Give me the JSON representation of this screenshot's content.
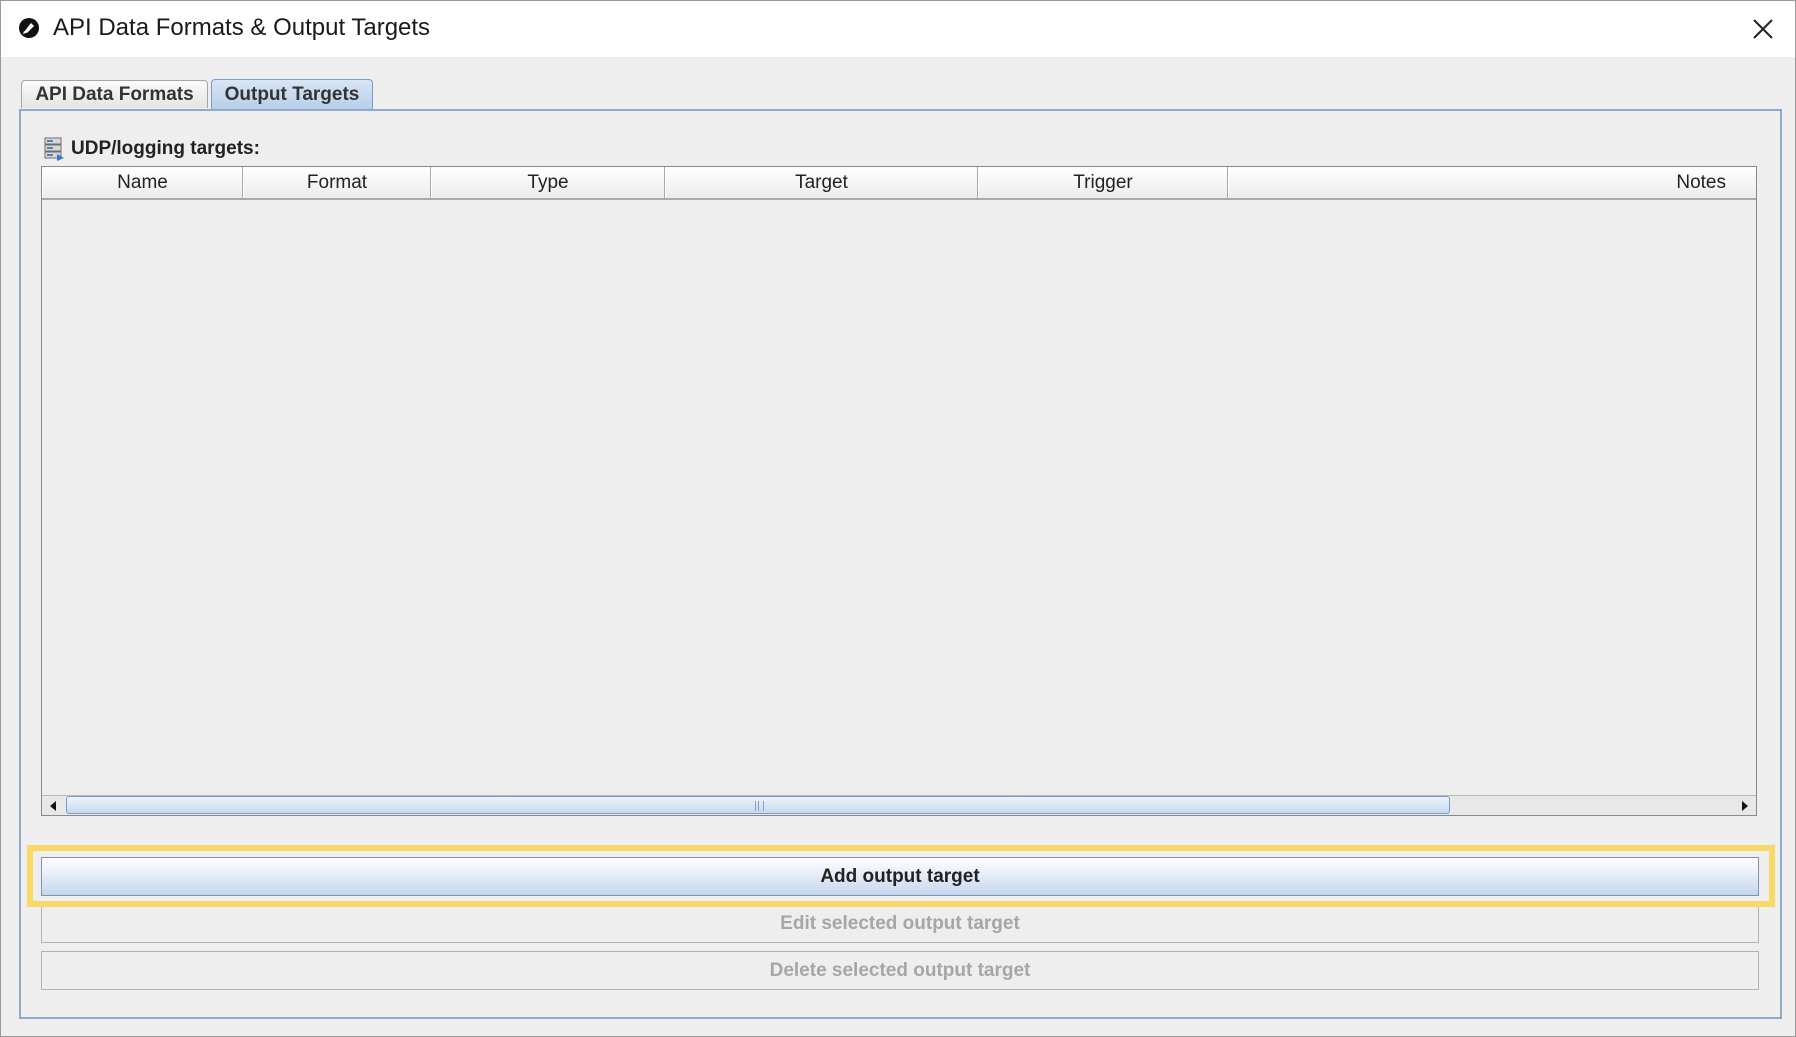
{
  "window": {
    "title": "API Data Formats & Output Targets"
  },
  "tabs": [
    {
      "label": "API Data Formats",
      "selected": false
    },
    {
      "label": "Output Targets",
      "selected": true
    }
  ],
  "section": {
    "label": "UDP/logging targets:",
    "icon": "server-icon"
  },
  "table": {
    "columns": [
      "Name",
      "Format",
      "Type",
      "Target",
      "Trigger",
      "Notes"
    ],
    "rows": []
  },
  "buttons": {
    "add_label": "Add output target",
    "edit_label": "Edit selected output target",
    "delete_label": "Delete selected output target"
  },
  "colors": {
    "highlight": "#f8d866",
    "selected_tab": "#b8cfe9"
  }
}
